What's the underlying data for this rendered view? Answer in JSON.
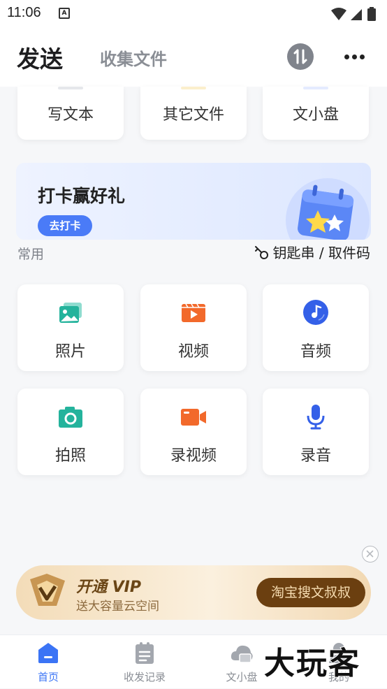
{
  "status_bar": {
    "time": "11:06",
    "sim_icon": "A"
  },
  "header": {
    "tab_send": "发送",
    "tab_collect": "收集文件",
    "sort_icon": "sort-icon",
    "more_icon": "more-icon"
  },
  "top_cards": [
    {
      "label": "写文本",
      "stub_color": "#e5e7eb"
    },
    {
      "label": "其它文件",
      "stub_color": "#fbefcc"
    },
    {
      "label": "文小盘",
      "stub_color": "#e4ebff"
    }
  ],
  "banner": {
    "title": "打卡赢好礼",
    "cta": "去打卡",
    "art_icon": "calendar-star-icon"
  },
  "section": {
    "label": "常用",
    "key_link": "钥匙串 / 取件码"
  },
  "grid": [
    {
      "label": "照片",
      "icon": "photo-icon",
      "color": "#24b39c"
    },
    {
      "label": "视频",
      "icon": "video-icon",
      "color": "#f2692b"
    },
    {
      "label": "音频",
      "icon": "audio-icon",
      "color": "#3460e8"
    },
    {
      "label": "拍照",
      "icon": "camera-icon",
      "color": "#24b39c"
    },
    {
      "label": "录视频",
      "icon": "video-camera-icon",
      "color": "#f2692b"
    },
    {
      "label": "录音",
      "icon": "microphone-icon",
      "color": "#3460e8"
    }
  ],
  "promo": {
    "title": "开通 VIP",
    "subtitle": "送大容量云空间",
    "button": "淘宝搜文叔叔"
  },
  "nav": [
    {
      "label": "首页",
      "icon": "home-icon",
      "active": true
    },
    {
      "label": "收发记录",
      "icon": "records-icon",
      "active": false
    },
    {
      "label": "文小盘",
      "icon": "cloud-drive-icon",
      "active": false
    },
    {
      "label": "我的",
      "icon": "profile-icon",
      "active": false
    }
  ],
  "watermark": "大玩客",
  "colors": {
    "accent": "#3b74f5",
    "promo_brown": "#6b3f10"
  }
}
